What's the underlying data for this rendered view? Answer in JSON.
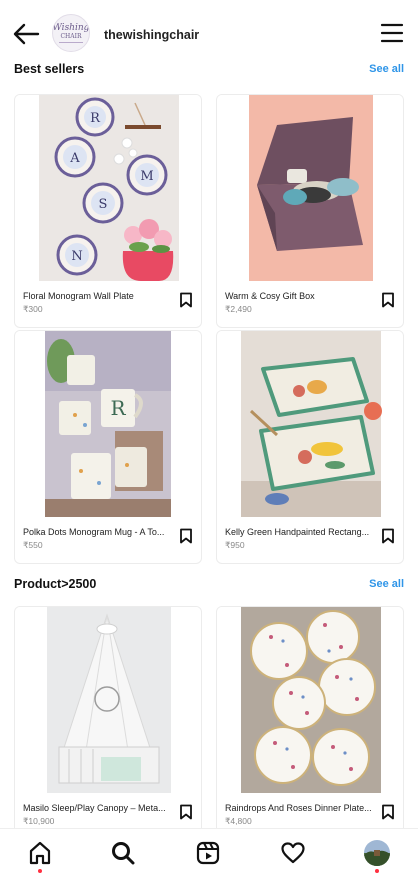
{
  "header": {
    "shop_name": "thewishingchair",
    "logo_text": "Wishing",
    "logo_subtext": "CHAIR",
    "back_icon": "arrow-left-icon",
    "menu_icon": "hamburger-icon"
  },
  "sections": [
    {
      "title": "Best sellers",
      "see_all": "See all",
      "products": [
        {
          "name": "Floral Monogram Wall Plate",
          "price": "₹300"
        },
        {
          "name": "Warm & Cosy Gift Box",
          "price": "₹2,490"
        },
        {
          "name": "Polka Dots Monogram Mug - A To...",
          "price": "₹550"
        },
        {
          "name": "Kelly Green Handpainted Rectang...",
          "price": "₹950"
        }
      ]
    },
    {
      "title": "Product>2500",
      "see_all": "See all",
      "products": [
        {
          "name": "Masilo Sleep/Play Canopy – Meta...",
          "price": "₹10,900"
        },
        {
          "name": "Raindrops And Roses Dinner Plate...",
          "price": "₹4,800"
        }
      ]
    }
  ],
  "plate_letters": [
    "R",
    "A",
    "M",
    "S",
    "N"
  ],
  "mug_letter": "R",
  "nav": {
    "items": [
      "home-icon",
      "search-icon",
      "reels-icon",
      "heart-icon",
      "profile-avatar"
    ],
    "active_dot_color": "#ff3040"
  },
  "colors": {
    "link": "#2f95e8",
    "price": "#888888"
  }
}
